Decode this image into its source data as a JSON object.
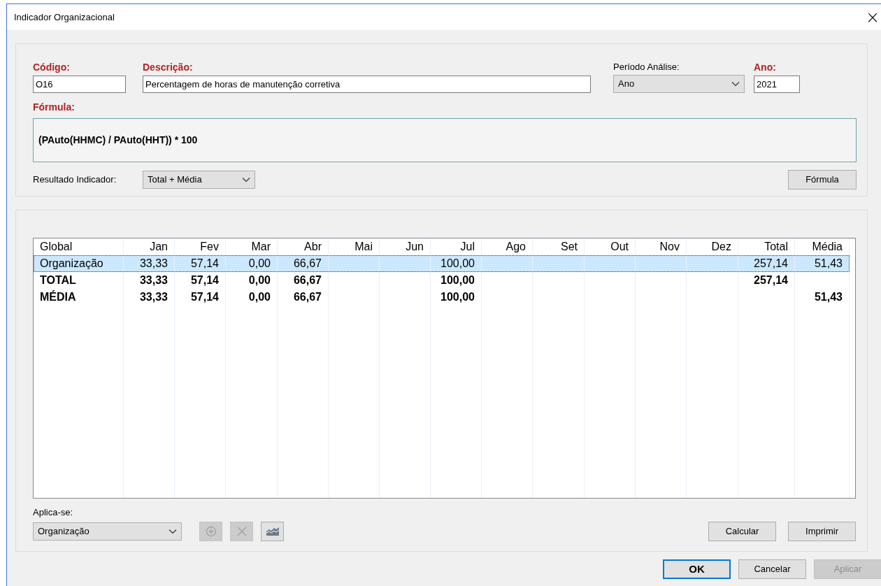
{
  "window": {
    "title": "Indicador Organizacional",
    "close": "×"
  },
  "header": {
    "codigo": {
      "label": "Código:",
      "value": "O16",
      "required": true
    },
    "descricao": {
      "label": "Descrição:",
      "value": "Percentagem de horas de manutenção corretiva",
      "required": true
    },
    "periodo": {
      "label": "Período Análise:",
      "value": "Ano",
      "required": false
    },
    "ano": {
      "label": "Ano:",
      "value": "2021",
      "required": true
    },
    "formula": {
      "label": "Fórmula:",
      "value": "(PAuto(HHMC) / PAuto(HHT)) * 100",
      "required": true
    },
    "resultado": {
      "label": "Resultado Indicador:",
      "value": "Total + Média"
    },
    "formula_button": {
      "label": "Fórmula",
      "disabled": false
    }
  },
  "table": {
    "columns": [
      "Global",
      "Jan",
      "Fev",
      "Mar",
      "Abr",
      "Mai",
      "Jun",
      "Jul",
      "Ago",
      "Set",
      "Out",
      "Nov",
      "Dez",
      "Total",
      "Média"
    ],
    "rows": [
      {
        "kind": "item",
        "selected": true,
        "cells": [
          "Organização",
          "33,33",
          "57,14",
          "0,00",
          "66,67",
          null,
          null,
          "100,00",
          null,
          null,
          null,
          null,
          null,
          "257,14",
          "51,43"
        ]
      },
      {
        "kind": "summary",
        "selected": false,
        "cells": [
          "TOTAL",
          "33,33",
          "57,14",
          "0,00",
          "66,67",
          null,
          null,
          "100,00",
          null,
          null,
          null,
          null,
          null,
          "257,14",
          null
        ]
      },
      {
        "kind": "summary",
        "selected": false,
        "cells": [
          "MÉDIA",
          "33,33",
          "57,14",
          "0,00",
          "66,67",
          null,
          null,
          "100,00",
          null,
          null,
          null,
          null,
          null,
          null,
          "51,43"
        ]
      }
    ]
  },
  "applies": {
    "label": "Aplica-se:",
    "value": "Organização",
    "tools": [
      {
        "kind": "add",
        "disabled": true
      },
      {
        "kind": "delete",
        "disabled": true
      },
      {
        "kind": "chart",
        "disabled": false
      }
    ],
    "buttons": [
      {
        "label": "Calcular",
        "disabled": false
      },
      {
        "label": "Imprimir",
        "disabled": false
      }
    ]
  },
  "footer": {
    "buttons": [
      {
        "label": "OK",
        "default": true,
        "disabled": false
      },
      {
        "label": "Cancelar",
        "default": false,
        "disabled": false
      },
      {
        "label": "Aplicar",
        "default": false,
        "disabled": true
      }
    ]
  }
}
